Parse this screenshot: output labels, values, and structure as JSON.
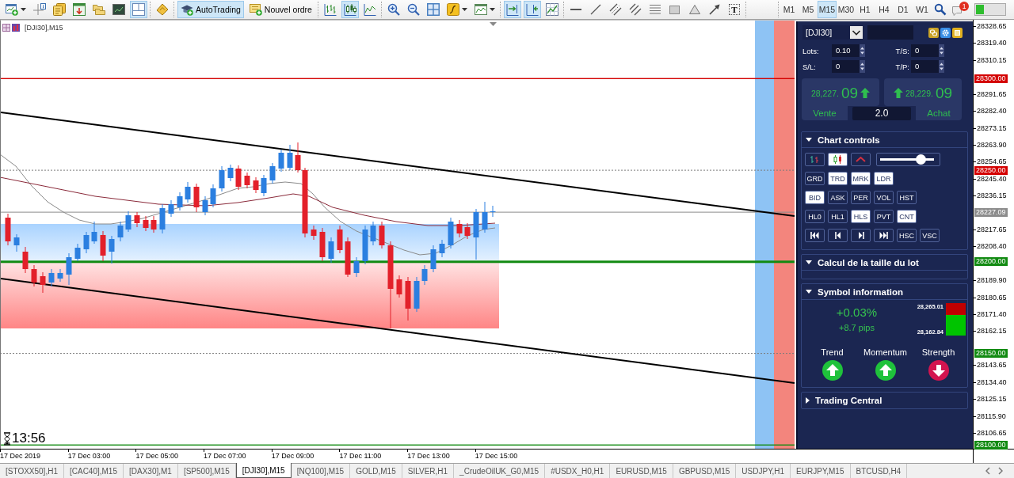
{
  "toolbar": {
    "items": [
      {
        "kind": "new-chart",
        "selected": false,
        "dropdown": true
      },
      {
        "kind": "data-window",
        "selected": false,
        "dropdown": false
      },
      {
        "kind": "market-watch",
        "selected": false,
        "dropdown": false
      },
      {
        "kind": "navigator",
        "selected": false,
        "dropdown": false
      },
      {
        "kind": "profiles",
        "selected": false,
        "dropdown": false
      },
      {
        "kind": "terminal",
        "selected": false,
        "dropdown": false
      },
      {
        "kind": "tester",
        "selected": true,
        "dropdown": false
      },
      {
        "kind": "separator"
      },
      {
        "kind": "editor",
        "selected": false,
        "dropdown": false
      },
      {
        "kind": "separator"
      },
      {
        "kind": "autotrading",
        "label": "AutoTrading",
        "selected": true,
        "dropdown": false
      },
      {
        "kind": "new-order",
        "label": "Nouvel ordre",
        "selected": false,
        "dropdown": false
      },
      {
        "kind": "separator"
      },
      {
        "kind": "bar-chart",
        "selected": false,
        "dropdown": false
      },
      {
        "kind": "candle-chart",
        "selected": true,
        "dropdown": false
      },
      {
        "kind": "line-chart",
        "selected": false,
        "dropdown": false
      },
      {
        "kind": "separator"
      },
      {
        "kind": "zoom-in",
        "selected": false,
        "dropdown": false
      },
      {
        "kind": "zoom-out",
        "selected": false,
        "dropdown": false
      },
      {
        "kind": "tile",
        "selected": false,
        "dropdown": false
      },
      {
        "kind": "indicators",
        "selected": false,
        "dropdown": true
      },
      {
        "kind": "templates",
        "selected": false,
        "dropdown": true
      },
      {
        "kind": "separator"
      },
      {
        "kind": "autoscroll",
        "selected": true,
        "dropdown": false
      },
      {
        "kind": "chart-shift",
        "selected": true,
        "dropdown": false
      },
      {
        "kind": "properties",
        "selected": false,
        "dropdown": false
      },
      {
        "kind": "separator"
      },
      {
        "kind": "hline",
        "selected": false,
        "dropdown": false
      },
      {
        "kind": "trendline",
        "selected": false,
        "dropdown": false
      },
      {
        "kind": "channel",
        "selected": false,
        "dropdown": false
      },
      {
        "kind": "fibo",
        "selected": false,
        "dropdown": false
      },
      {
        "kind": "fibo-fan",
        "selected": false,
        "dropdown": false
      },
      {
        "kind": "rectangle",
        "selected": false,
        "dropdown": false
      },
      {
        "kind": "triangle",
        "selected": false,
        "dropdown": false
      },
      {
        "kind": "arrow",
        "selected": false,
        "dropdown": false
      },
      {
        "kind": "text-tool",
        "label": "T",
        "selected": false,
        "dropdown": false
      },
      {
        "kind": "separator"
      }
    ],
    "timeframes": [
      {
        "label": "M1",
        "selected": false
      },
      {
        "label": "M5",
        "selected": false
      },
      {
        "label": "M15",
        "selected": true
      },
      {
        "label": "M30",
        "selected": false
      },
      {
        "label": "H1",
        "selected": false
      },
      {
        "label": "H4",
        "selected": false
      },
      {
        "label": "D1",
        "selected": false
      },
      {
        "label": "W1",
        "selected": false
      }
    ],
    "notification_count": "1"
  },
  "chart": {
    "title": "[DJI30],M15",
    "timer": "13:56",
    "price_ticks": [
      "28328.65",
      "28319.40",
      "28310.15",
      "28291.65",
      "28282.40",
      "28273.15",
      "28263.90",
      "28254.65",
      "28245.40",
      "28236.15",
      "28217.65",
      "28208.40",
      "28189.90",
      "28180.65",
      "28171.40",
      "28162.15",
      "28143.65",
      "28134.40",
      "28125.15",
      "28115.90",
      "28106.65"
    ],
    "price_levels": [
      {
        "price": "28300.00",
        "color": "#d40000",
        "kind": "solid"
      },
      {
        "price": "28250.00",
        "color": "#d40000",
        "kind": "dotted"
      },
      {
        "price": "28227.09",
        "color": "#8c8c8c",
        "kind": "thin"
      },
      {
        "price": "28200.00",
        "color": "#118a11",
        "kind": "thick"
      },
      {
        "price": "28150.00",
        "color": "#118a11",
        "kind": "dotted"
      },
      {
        "price": "28100.00",
        "color": "#118a11",
        "kind": "solid"
      }
    ],
    "time_labels": [
      "17 Dec 2019",
      "17 Dec 03:00",
      "17 Dec 05:00",
      "17 Dec 07:00",
      "17 Dec 09:00",
      "17 Dec 11:00",
      "17 Dec 13:00",
      "17 Dec 15:00"
    ]
  },
  "trading_panel": {
    "symbol": "[DJI30]",
    "fields": [
      {
        "label": "Lots:",
        "value": "0.10"
      },
      {
        "label": "T/S:",
        "value": "0"
      },
      {
        "label": "S/L:",
        "value": "0"
      },
      {
        "label": "T/P:",
        "value": "0"
      }
    ],
    "sell": {
      "price": "28,227.",
      "pips": "09",
      "label": "Vente",
      "up": true
    },
    "buy": {
      "price": "28,229.",
      "pips": "09",
      "label": "Achat",
      "up": true
    },
    "lot_size": "2.0",
    "sections": [
      {
        "kind": "chart-controls",
        "title": "Chart controls",
        "expanded": true,
        "rows": [
          [
            {
              "kind": "bars",
              "on": false
            },
            {
              "kind": "candles",
              "on": true
            },
            {
              "kind": "line",
              "on": false
            },
            {
              "kind": "slider",
              "level": 0.75
            }
          ],
          [
            {
              "kind": "text",
              "label": "GRD",
              "on": false
            },
            {
              "kind": "text",
              "label": "TRD",
              "on": true
            },
            {
              "kind": "text",
              "label": "MRK",
              "on": true
            },
            {
              "kind": "text",
              "label": "LDR",
              "on": true
            }
          ],
          [
            {
              "kind": "text",
              "label": "BID",
              "on": true
            },
            {
              "kind": "text",
              "label": "ASK",
              "on": false
            },
            {
              "kind": "text",
              "label": "PER",
              "on": false
            },
            {
              "kind": "text",
              "label": "VOL",
              "on": false
            },
            {
              "kind": "text",
              "label": "HST",
              "on": false
            }
          ],
          [
            {
              "kind": "text",
              "label": "HL0",
              "on": false
            },
            {
              "kind": "text",
              "label": "HL1",
              "on": false
            },
            {
              "kind": "text",
              "label": "HLS",
              "on": true
            },
            {
              "kind": "text",
              "label": "PVT",
              "on": false
            },
            {
              "kind": "text",
              "label": "CNT",
              "on": true
            }
          ],
          [
            {
              "kind": "first",
              "on": false
            },
            {
              "kind": "prev",
              "on": false
            },
            {
              "kind": "next",
              "on": false
            },
            {
              "kind": "last",
              "on": false
            },
            {
              "kind": "text",
              "label": "HSC",
              "on": false
            },
            {
              "kind": "text",
              "label": "VSC",
              "on": false
            }
          ]
        ]
      },
      {
        "kind": "lot-calculator",
        "title": "Calcul de la taille du lot",
        "expanded": true
      },
      {
        "kind": "symbol-info",
        "title": "Symbol information",
        "expanded": true,
        "change": "+0.03%",
        "change_pips": "+8.7 pips",
        "high": "28,265.01",
        "low": "28,162.84",
        "range": {
          "level": 0.63
        },
        "signals": [
          {
            "label": "Trend",
            "up": true
          },
          {
            "label": "Momentum",
            "up": true
          },
          {
            "label": "Strength",
            "up": false
          }
        ]
      },
      {
        "kind": "trading-central",
        "title": "Trading Central",
        "expanded": false
      }
    ]
  },
  "tabs": [
    {
      "label": "[STOXX50],H1",
      "selected": false
    },
    {
      "label": "[CAC40],M15",
      "selected": false
    },
    {
      "label": "[DAX30],M1",
      "selected": false
    },
    {
      "label": "[SP500],M15",
      "selected": false
    },
    {
      "label": "[DJI30],M15",
      "selected": true
    },
    {
      "label": "[NQ100],M15",
      "selected": false
    },
    {
      "label": "GOLD,M15",
      "selected": false
    },
    {
      "label": "SILVER,H1",
      "selected": false
    },
    {
      "label": "_CrudeOilUK_G0,M15",
      "selected": false
    },
    {
      "label": "#USDX_H0,H1",
      "selected": false
    },
    {
      "label": "EURUSD,M15",
      "selected": false
    },
    {
      "label": "GBPUSD,M15",
      "selected": false
    },
    {
      "label": "USDJPY,H1",
      "selected": false
    },
    {
      "label": "EURJPY,M15",
      "selected": false
    },
    {
      "label": "BTCUSD,H4",
      "selected": false
    }
  ]
}
